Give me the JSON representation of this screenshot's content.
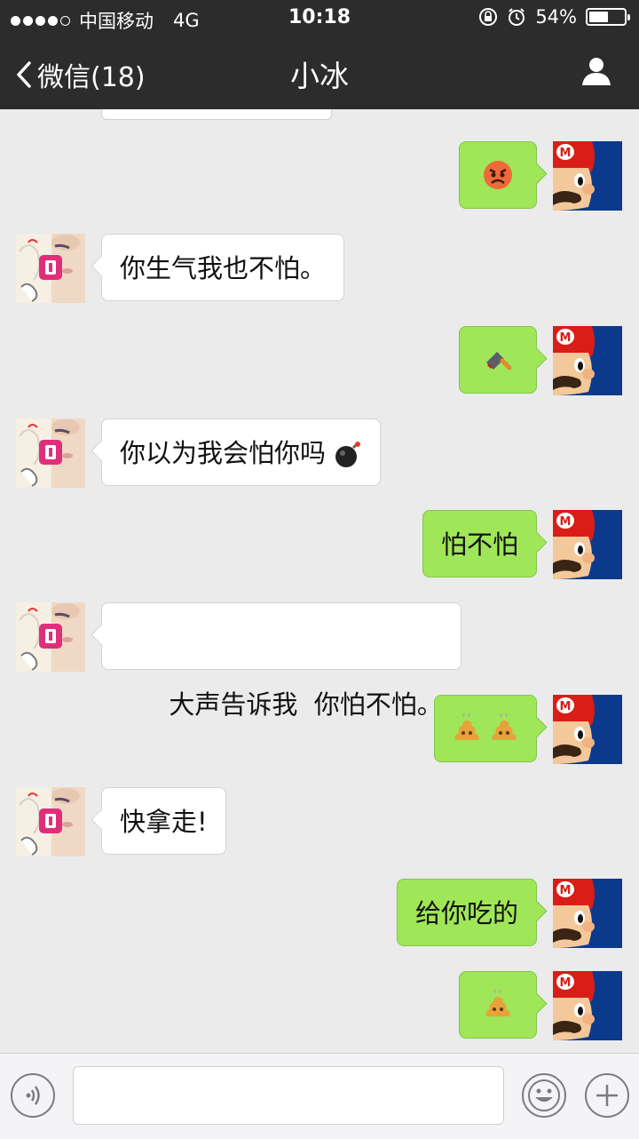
{
  "status_bar": {
    "carrier": "中国移动",
    "network": "4G",
    "time": "10:18",
    "battery": "54%",
    "battery_level": 0.54
  },
  "nav": {
    "back_label": "微信(18)",
    "title": "小冰"
  },
  "messages": [
    {
      "from": "me",
      "type": "emoji",
      "emoji": "angry-face"
    },
    {
      "from": "bot",
      "type": "text",
      "text": "你生气我也不怕。"
    },
    {
      "from": "me",
      "type": "emoji",
      "emoji": "cleaver-knife"
    },
    {
      "from": "bot",
      "type": "text",
      "text": "你以为我会怕你吗",
      "emoji": "bomb"
    },
    {
      "from": "me",
      "type": "text",
      "text": "怕不怕"
    },
    {
      "from": "bot",
      "type": "text",
      "text": "大声告诉我  你怕不怕。"
    },
    {
      "from": "me",
      "type": "emoji",
      "emoji": "poop-x2"
    },
    {
      "from": "bot",
      "type": "text",
      "text": "快拿走!"
    },
    {
      "from": "me",
      "type": "text",
      "text": "给你吃的"
    },
    {
      "from": "me",
      "type": "emoji",
      "emoji": "poop"
    }
  ],
  "input": {
    "value": "",
    "placeholder": ""
  },
  "icons": {
    "back": "chevron-left-icon",
    "profile": "person-icon",
    "voice": "voice-icon",
    "emoji": "smiley-icon",
    "more": "plus-icon"
  },
  "colors": {
    "bar": "#2c2c2c",
    "chat_bg": "#ebebeb",
    "my_bubble": "#9fe658",
    "bot_bubble": "#ffffff"
  }
}
